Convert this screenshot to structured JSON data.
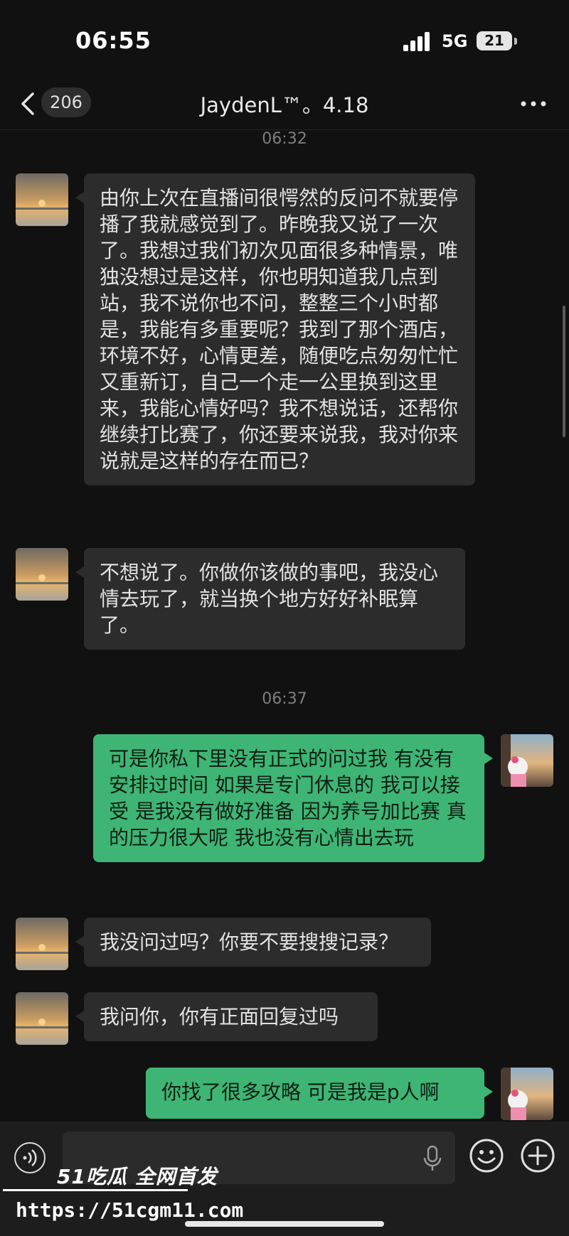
{
  "status_bar": {
    "time": "06:55",
    "network": "5G",
    "battery": "21"
  },
  "header": {
    "unread_count": "206",
    "title": "JaydenL™。4.18"
  },
  "messages": [
    {
      "type": "timestamp",
      "text": "06:32"
    },
    {
      "type": "incoming",
      "text": "由你上次在直播间很愕然的反问不就要停播了我就感觉到了。昨晚我又说了一次了。我想过我们初次见面很多种情景，唯独没想过是这样，你也明知道我几点到站，我不说你也不问，整整三个小时都是，我能有多重要呢？我到了那个酒店，环境不好，心情更差，随便吃点匆匆忙忙又重新订，自己一个走一公里换到这里来，我能心情好吗？我不想说话，还帮你继续打比赛了，你还要来说我，我对你来说就是这样的存在而已？"
    },
    {
      "type": "incoming",
      "text": "不想说了。你做你该做的事吧，我没心情去玩了，就当换个地方好好补眠算了。"
    },
    {
      "type": "timestamp",
      "text": "06:37"
    },
    {
      "type": "outgoing",
      "text": "可是你私下里没有正式的问过我 有没有安排过时间 如果是专门休息的 我可以接受 是我没有做好准备 因为养号加比赛 真的压力很大呢 我也没有心情出去玩"
    },
    {
      "type": "incoming",
      "text": "我没问过吗？你要不要搜搜记录？"
    },
    {
      "type": "incoming",
      "text": "我问你，你有正面回复过吗"
    },
    {
      "type": "outgoing",
      "text": "你找了很多攻略 可是我是p人啊"
    }
  ],
  "input": {
    "value": ""
  },
  "watermark": {
    "brand": "51吃瓜 全网首发",
    "url": "https://51cgm11.com"
  },
  "icons": {
    "back": "chevron-left-icon",
    "more": "more-dots-icon",
    "voice": "voice-icon",
    "mic": "microphone-icon",
    "emoji": "emoji-icon",
    "plus": "plus-icon"
  },
  "colors": {
    "background": "#111111",
    "incoming_bubble": "#2c2c2c",
    "outgoing_bubble": "#3eb575"
  }
}
